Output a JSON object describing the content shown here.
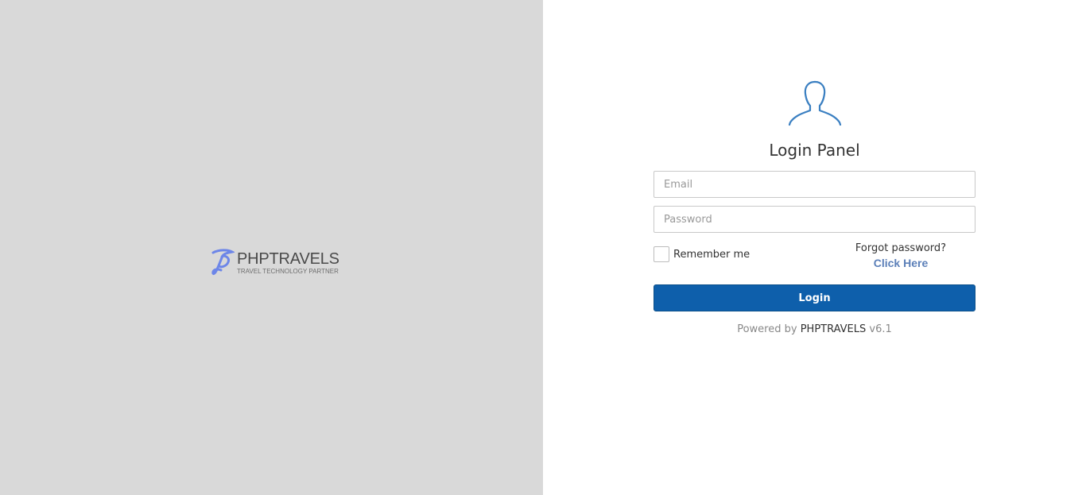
{
  "brand": {
    "name": "PHPTRAVELS",
    "tagline": "TRAVEL TECHNOLOGY PARTNER",
    "accent_color": "#6d86e8"
  },
  "login": {
    "title": "Login Panel",
    "email_placeholder": "Email",
    "password_placeholder": "Password",
    "remember_label": "Remember me",
    "forgot_text": "Forgot password?",
    "forgot_link": "Click Here",
    "button_label": "Login",
    "powered_prefix": "Powered by",
    "powered_brand": "PHPTRAVELS",
    "powered_version": "v6.1"
  },
  "colors": {
    "left_background": "#d9d9d9",
    "button_background": "#0e5fab",
    "icon_color": "#3a7fc1",
    "link_color": "#5b7fb8"
  },
  "icons": {
    "user": "user-outline-icon",
    "brand_mark": "phptravels-logo-icon"
  }
}
